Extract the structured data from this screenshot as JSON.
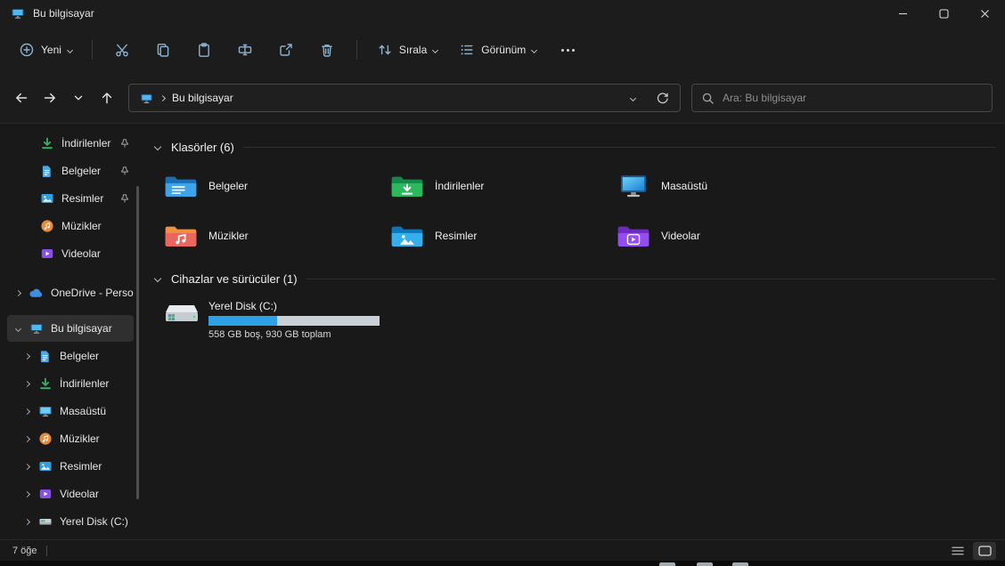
{
  "window": {
    "title": "Bu bilgisayar"
  },
  "toolbar": {
    "new_label": "Yeni",
    "sort_label": "Sırala",
    "view_label": "Görünüm"
  },
  "navbar": {
    "breadcrumb_root": "Bu bilgisayar",
    "search_placeholder": "Ara: Bu bilgisayar"
  },
  "sidebar": {
    "pinned": [
      {
        "label": "İndirilenler",
        "icon": "downloads-icon",
        "pinned": true
      },
      {
        "label": "Belgeler",
        "icon": "document-icon",
        "pinned": true
      },
      {
        "label": "Resimler",
        "icon": "pictures-icon",
        "pinned": true
      },
      {
        "label": "Müzikler",
        "icon": "music-icon",
        "pinned": false
      },
      {
        "label": "Videolar",
        "icon": "videos-icon",
        "pinned": false
      }
    ],
    "onedrive": {
      "label": "OneDrive - Perso",
      "icon": "onedrive-cloud-icon"
    },
    "this_pc": {
      "label": "Bu bilgisayar",
      "icon": "computer-icon",
      "selected": true
    },
    "children": [
      {
        "label": "Belgeler",
        "icon": "document-icon"
      },
      {
        "label": "İndirilenler",
        "icon": "downloads-icon"
      },
      {
        "label": "Masaüstü",
        "icon": "desktop-icon"
      },
      {
        "label": "Müzikler",
        "icon": "music-icon"
      },
      {
        "label": "Resimler",
        "icon": "pictures-icon"
      },
      {
        "label": "Videolar",
        "icon": "videos-icon"
      },
      {
        "label": "Yerel Disk (C:)",
        "icon": "hard-drive-icon"
      }
    ]
  },
  "main": {
    "folders_section": {
      "title": "Klasörler (6)"
    },
    "folders": [
      {
        "name": "Belgeler",
        "icon": "documents-folder-icon"
      },
      {
        "name": "İndirilenler",
        "icon": "downloads-folder-icon"
      },
      {
        "name": "Masaüstü",
        "icon": "desktop-folder-icon"
      },
      {
        "name": "Müzikler",
        "icon": "music-folder-icon"
      },
      {
        "name": "Resimler",
        "icon": "pictures-folder-icon"
      },
      {
        "name": "Videolar",
        "icon": "videos-folder-icon"
      }
    ],
    "devices_section": {
      "title": "Cihazlar ve sürücüler (1)"
    },
    "drive": {
      "name": "Yerel Disk (C:)",
      "capacity_text": "558 GB boş, 930 GB toplam",
      "used_percent": 40,
      "fill_style": "width:40%"
    }
  },
  "statusbar": {
    "items_count": "7 öğe"
  },
  "colors": {
    "accent": "#4cc2ff",
    "drive_fill": "#2da0e8",
    "folder_blue": "#3fa3e8",
    "folder_green": "#2cb85c",
    "folder_orange": "#ef9140",
    "folder_purple": "#934df0"
  }
}
